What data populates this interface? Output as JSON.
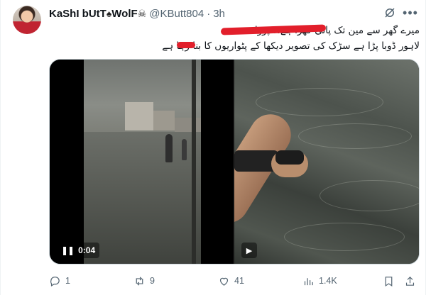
{
  "author": {
    "display_name": "KaShI bUtT",
    "name_icon_a": "♠",
    "name_suffix": "WolF",
    "name_icon_b": "☠",
    "handle": "@KButt804",
    "separator": "·",
    "time": "3h"
  },
  "header_icons": [
    "grok-icon",
    "more-icon"
  ],
  "tweet": {
    "line1": "میرے گھر سے مین تک پانی کھڑا ہے!! پورا",
    "line2": "لاہور ڈوبا پڑا ہے سڑک کی تصویر دیکھا کے پٹواریوں کا بنا رہا ہے"
  },
  "media": {
    "video1": {
      "elapsed": "0:04",
      "control_icon": "pause-icon"
    },
    "video2": {
      "control_icon": "play-icon"
    }
  },
  "actions": {
    "replies": "1",
    "reposts": "9",
    "likes": "41",
    "views": "1.4K"
  },
  "colors": {
    "redaction": "#e21f2b",
    "muted": "#536471",
    "border": "#cfd9de"
  }
}
